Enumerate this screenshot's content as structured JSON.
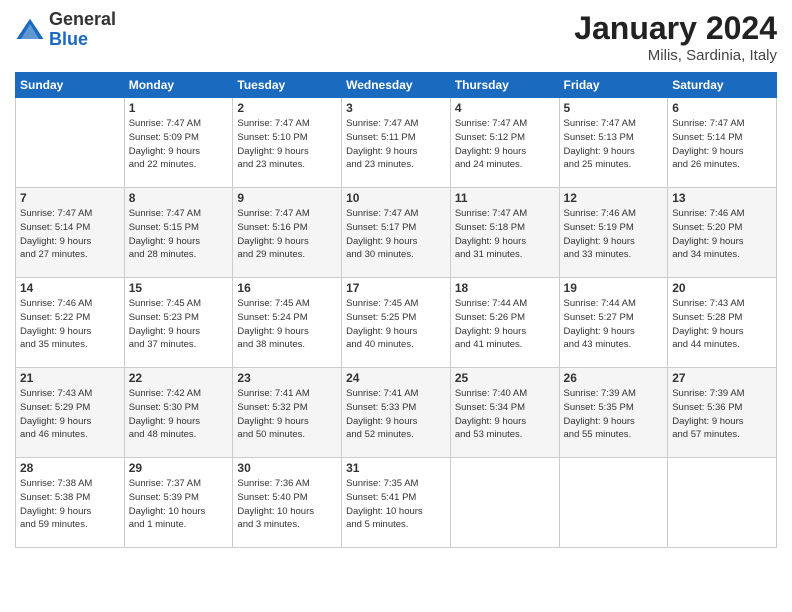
{
  "header": {
    "logo": {
      "general": "General",
      "blue": "Blue"
    },
    "title": "January 2024",
    "location": "Milis, Sardinia, Italy"
  },
  "weekdays": [
    "Sunday",
    "Monday",
    "Tuesday",
    "Wednesday",
    "Thursday",
    "Friday",
    "Saturday"
  ],
  "weeks": [
    [
      {
        "num": "",
        "info": ""
      },
      {
        "num": "1",
        "info": "Sunrise: 7:47 AM\nSunset: 5:09 PM\nDaylight: 9 hours\nand 22 minutes."
      },
      {
        "num": "2",
        "info": "Sunrise: 7:47 AM\nSunset: 5:10 PM\nDaylight: 9 hours\nand 23 minutes."
      },
      {
        "num": "3",
        "info": "Sunrise: 7:47 AM\nSunset: 5:11 PM\nDaylight: 9 hours\nand 23 minutes."
      },
      {
        "num": "4",
        "info": "Sunrise: 7:47 AM\nSunset: 5:12 PM\nDaylight: 9 hours\nand 24 minutes."
      },
      {
        "num": "5",
        "info": "Sunrise: 7:47 AM\nSunset: 5:13 PM\nDaylight: 9 hours\nand 25 minutes."
      },
      {
        "num": "6",
        "info": "Sunrise: 7:47 AM\nSunset: 5:14 PM\nDaylight: 9 hours\nand 26 minutes."
      }
    ],
    [
      {
        "num": "7",
        "info": "Sunrise: 7:47 AM\nSunset: 5:14 PM\nDaylight: 9 hours\nand 27 minutes."
      },
      {
        "num": "8",
        "info": "Sunrise: 7:47 AM\nSunset: 5:15 PM\nDaylight: 9 hours\nand 28 minutes."
      },
      {
        "num": "9",
        "info": "Sunrise: 7:47 AM\nSunset: 5:16 PM\nDaylight: 9 hours\nand 29 minutes."
      },
      {
        "num": "10",
        "info": "Sunrise: 7:47 AM\nSunset: 5:17 PM\nDaylight: 9 hours\nand 30 minutes."
      },
      {
        "num": "11",
        "info": "Sunrise: 7:47 AM\nSunset: 5:18 PM\nDaylight: 9 hours\nand 31 minutes."
      },
      {
        "num": "12",
        "info": "Sunrise: 7:46 AM\nSunset: 5:19 PM\nDaylight: 9 hours\nand 33 minutes."
      },
      {
        "num": "13",
        "info": "Sunrise: 7:46 AM\nSunset: 5:20 PM\nDaylight: 9 hours\nand 34 minutes."
      }
    ],
    [
      {
        "num": "14",
        "info": "Sunrise: 7:46 AM\nSunset: 5:22 PM\nDaylight: 9 hours\nand 35 minutes."
      },
      {
        "num": "15",
        "info": "Sunrise: 7:45 AM\nSunset: 5:23 PM\nDaylight: 9 hours\nand 37 minutes."
      },
      {
        "num": "16",
        "info": "Sunrise: 7:45 AM\nSunset: 5:24 PM\nDaylight: 9 hours\nand 38 minutes."
      },
      {
        "num": "17",
        "info": "Sunrise: 7:45 AM\nSunset: 5:25 PM\nDaylight: 9 hours\nand 40 minutes."
      },
      {
        "num": "18",
        "info": "Sunrise: 7:44 AM\nSunset: 5:26 PM\nDaylight: 9 hours\nand 41 minutes."
      },
      {
        "num": "19",
        "info": "Sunrise: 7:44 AM\nSunset: 5:27 PM\nDaylight: 9 hours\nand 43 minutes."
      },
      {
        "num": "20",
        "info": "Sunrise: 7:43 AM\nSunset: 5:28 PM\nDaylight: 9 hours\nand 44 minutes."
      }
    ],
    [
      {
        "num": "21",
        "info": "Sunrise: 7:43 AM\nSunset: 5:29 PM\nDaylight: 9 hours\nand 46 minutes."
      },
      {
        "num": "22",
        "info": "Sunrise: 7:42 AM\nSunset: 5:30 PM\nDaylight: 9 hours\nand 48 minutes."
      },
      {
        "num": "23",
        "info": "Sunrise: 7:41 AM\nSunset: 5:32 PM\nDaylight: 9 hours\nand 50 minutes."
      },
      {
        "num": "24",
        "info": "Sunrise: 7:41 AM\nSunset: 5:33 PM\nDaylight: 9 hours\nand 52 minutes."
      },
      {
        "num": "25",
        "info": "Sunrise: 7:40 AM\nSunset: 5:34 PM\nDaylight: 9 hours\nand 53 minutes."
      },
      {
        "num": "26",
        "info": "Sunrise: 7:39 AM\nSunset: 5:35 PM\nDaylight: 9 hours\nand 55 minutes."
      },
      {
        "num": "27",
        "info": "Sunrise: 7:39 AM\nSunset: 5:36 PM\nDaylight: 9 hours\nand 57 minutes."
      }
    ],
    [
      {
        "num": "28",
        "info": "Sunrise: 7:38 AM\nSunset: 5:38 PM\nDaylight: 9 hours\nand 59 minutes."
      },
      {
        "num": "29",
        "info": "Sunrise: 7:37 AM\nSunset: 5:39 PM\nDaylight: 10 hours\nand 1 minute."
      },
      {
        "num": "30",
        "info": "Sunrise: 7:36 AM\nSunset: 5:40 PM\nDaylight: 10 hours\nand 3 minutes."
      },
      {
        "num": "31",
        "info": "Sunrise: 7:35 AM\nSunset: 5:41 PM\nDaylight: 10 hours\nand 5 minutes."
      },
      {
        "num": "",
        "info": ""
      },
      {
        "num": "",
        "info": ""
      },
      {
        "num": "",
        "info": ""
      }
    ]
  ]
}
